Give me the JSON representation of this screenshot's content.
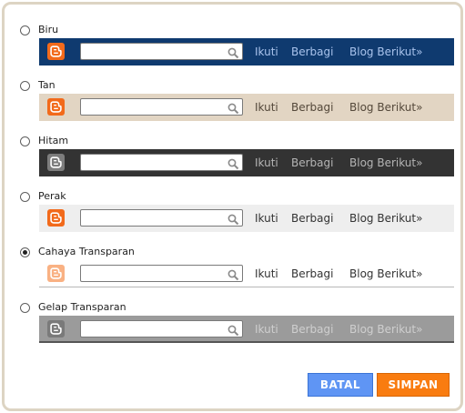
{
  "options": [
    {
      "label": "Biru",
      "checked": false,
      "bar_bg": "#0f3a6f",
      "border": "none",
      "link_color": "#a9c3ec",
      "logo_bg": "#f26a1b",
      "logo_fg": "#ffffff",
      "search_placeholder": "",
      "search_value": "",
      "links": [
        "Ikuti",
        "Berbagi",
        "Blog Berikut»"
      ]
    },
    {
      "label": "Tan",
      "checked": false,
      "bar_bg": "#e2d5c3",
      "border": "none",
      "link_color": "#54483a",
      "logo_bg": "#f26a1b",
      "logo_fg": "#ffffff",
      "search_placeholder": "",
      "search_value": "",
      "links": [
        "Ikuti",
        "Berbagi",
        "Blog Berikut»"
      ]
    },
    {
      "label": "Hitam",
      "checked": false,
      "bar_bg": "#333333",
      "border": "none",
      "link_color": "#b5b5b5",
      "logo_bg": "#7d7d7d",
      "logo_fg": "#ffffff",
      "search_placeholder": "",
      "search_value": "",
      "links": [
        "Ikuti",
        "Berbagi",
        "Blog Berikut»"
      ]
    },
    {
      "label": "Perak",
      "checked": false,
      "bar_bg": "#eeeeee",
      "border": "none",
      "link_color": "#333333",
      "logo_bg": "#f26a1b",
      "logo_fg": "#ffffff",
      "search_placeholder": "",
      "search_value": "",
      "links": [
        "Ikuti",
        "Berbagi",
        "Blog Berikut»"
      ]
    },
    {
      "label": "Cahaya Transparan",
      "checked": true,
      "bar_bg": "#ffffff",
      "border": "bottom",
      "link_color": "#333333",
      "logo_bg": "#f9b183",
      "logo_fg": "#ffffff",
      "search_placeholder": "",
      "search_value": "",
      "links": [
        "Ikuti",
        "Berbagi",
        "Blog Berikut»"
      ]
    },
    {
      "label": "Gelap Transparan",
      "checked": false,
      "bar_bg": "#9b9b9b",
      "border": "bottom-dark",
      "link_color": "#cfcfcf",
      "logo_bg": "#7a7a7a",
      "logo_fg": "#ffffff",
      "search_placeholder": "",
      "search_value": "",
      "links": [
        "Ikuti",
        "Berbagi",
        "Blog Berikut»"
      ]
    }
  ],
  "buttons": {
    "cancel_label": "BATAL",
    "save_label": "SIMPAN"
  },
  "icons": {
    "logo": "blogger-logo-icon",
    "search": "magnifier-icon"
  }
}
